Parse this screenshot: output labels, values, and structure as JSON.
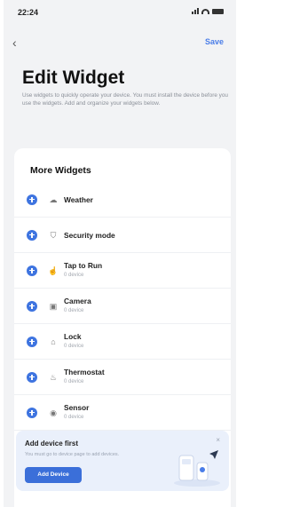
{
  "status_bar": {
    "time": "22:24"
  },
  "nav": {
    "back_glyph": "‹",
    "save_label": "Save"
  },
  "header": {
    "title": "Edit Widget",
    "description": "Use widgets to quickly operate your device. You must install the device before you use the widgets. Add and organize your widgets below."
  },
  "section": {
    "title": "More Widgets"
  },
  "widgets": [
    {
      "name": "Weather",
      "subtitle": "",
      "icon": "cloud-icon",
      "glyph": "☁"
    },
    {
      "name": "Security mode",
      "subtitle": "",
      "icon": "shield-icon",
      "glyph": "⛉"
    },
    {
      "name": "Tap to Run",
      "subtitle": "0 device",
      "icon": "tap-icon",
      "glyph": "☝"
    },
    {
      "name": "Camera",
      "subtitle": "0 device",
      "icon": "camera-icon",
      "glyph": "▣"
    },
    {
      "name": "Lock",
      "subtitle": "0 device",
      "icon": "lock-icon",
      "glyph": "⌂"
    },
    {
      "name": "Thermostat",
      "subtitle": "0 device",
      "icon": "thermometer-icon",
      "glyph": "♨"
    },
    {
      "name": "Sensor",
      "subtitle": "0 device",
      "icon": "sensor-icon",
      "glyph": "◉"
    }
  ],
  "banner": {
    "title": "Add device first",
    "description": "You must go to device page to add devices.",
    "button_label": "Add Device",
    "close_glyph": "×"
  },
  "colors": {
    "accent": "#3e74e0",
    "background": "#f2f3f5",
    "banner_bg": "#eaf0fb"
  }
}
